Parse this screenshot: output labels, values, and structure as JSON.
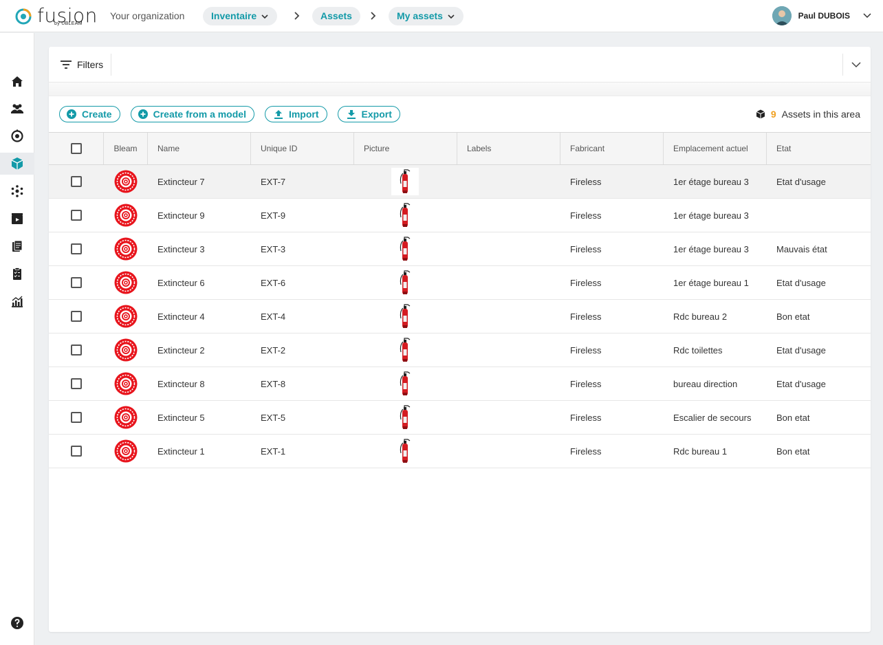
{
  "header": {
    "logo_text": "fusion",
    "logo_sub": "by UBLEAM",
    "organization": "Your organization",
    "breadcrumbs": [
      {
        "label": "Inventaire",
        "dropdown": true
      },
      {
        "label": "Assets",
        "dropdown": false
      },
      {
        "label": "My assets",
        "dropdown": true
      }
    ],
    "user_name": "Paul DUBOIS"
  },
  "sidebar": {
    "items": [
      {
        "icon": "home-icon"
      },
      {
        "icon": "users-icon"
      },
      {
        "icon": "target-icon"
      },
      {
        "icon": "cube-icon",
        "active": true
      },
      {
        "icon": "network-icon"
      },
      {
        "icon": "media-icon"
      },
      {
        "icon": "documents-icon"
      },
      {
        "icon": "checklist-icon"
      },
      {
        "icon": "analytics-icon"
      }
    ],
    "help_icon": "help-icon"
  },
  "filters": {
    "label": "Filters"
  },
  "toolbar": {
    "create": "Create",
    "create_from_model": "Create from a model",
    "import": "Import",
    "export": "Export"
  },
  "count": {
    "number": "9",
    "label": "Assets in this area"
  },
  "table": {
    "headers": {
      "bleam": "Bleam",
      "name": "Name",
      "unique_id": "Unique ID",
      "picture": "Picture",
      "labels": "Labels",
      "fabricant": "Fabricant",
      "emplacement": "Emplacement actuel",
      "etat": "Etat"
    },
    "rows": [
      {
        "name": "Extincteur 7",
        "uid": "EXT-7",
        "labels": "",
        "fabricant": "Fireless",
        "emplacement": "1er étage bureau 3",
        "etat": "Etat d'usage"
      },
      {
        "name": "Extincteur 9",
        "uid": "EXT-9",
        "labels": "",
        "fabricant": "Fireless",
        "emplacement": "1er étage bureau 3",
        "etat": ""
      },
      {
        "name": "Extincteur 3",
        "uid": "EXT-3",
        "labels": "",
        "fabricant": "Fireless",
        "emplacement": "1er étage bureau 3",
        "etat": "Mauvais état"
      },
      {
        "name": "Extincteur 6",
        "uid": "EXT-6",
        "labels": "",
        "fabricant": "Fireless",
        "emplacement": "1er étage bureau 1",
        "etat": "Etat d'usage"
      },
      {
        "name": "Extincteur 4",
        "uid": "EXT-4",
        "labels": "",
        "fabricant": "Fireless",
        "emplacement": "Rdc bureau 2",
        "etat": "Bon etat"
      },
      {
        "name": "Extincteur 2",
        "uid": "EXT-2",
        "labels": "",
        "fabricant": "Fireless",
        "emplacement": "Rdc toilettes",
        "etat": "Etat d'usage"
      },
      {
        "name": "Extincteur 8",
        "uid": "EXT-8",
        "labels": "",
        "fabricant": "Fireless",
        "emplacement": "bureau direction",
        "etat": "Etat d'usage"
      },
      {
        "name": "Extincteur 5",
        "uid": "EXT-5",
        "labels": "",
        "fabricant": "Fireless",
        "emplacement": "Escalier de secours",
        "etat": "Bon etat"
      },
      {
        "name": "Extincteur 1",
        "uid": "EXT-1",
        "labels": "",
        "fabricant": "Fireless",
        "emplacement": "Rdc bureau 1",
        "etat": "Bon etat"
      }
    ]
  },
  "colors": {
    "accent": "#139aa8",
    "count_number": "#f0a020",
    "bleam_red": "#e8141c"
  }
}
